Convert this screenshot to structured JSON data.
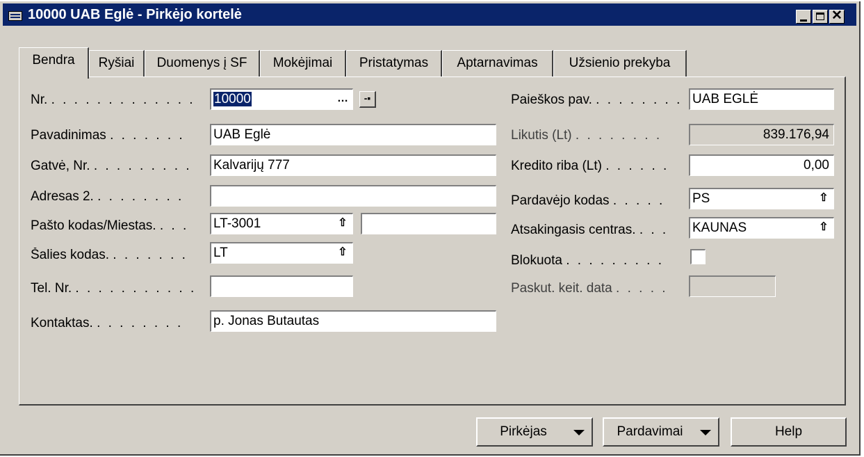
{
  "window": {
    "title": "10000 UAB Eglė - Pirkėjo kortelė",
    "close_glyph": "✕"
  },
  "tabs": [
    {
      "label": "Bendra"
    },
    {
      "label": "Ryšiai"
    },
    {
      "label": "Duomenys į SF"
    },
    {
      "label": "Mokėjimai"
    },
    {
      "label": "Pristatymas"
    },
    {
      "label": "Aptarnavimas"
    },
    {
      "label": "Užsienio prekyba"
    }
  ],
  "active_tab": "Bendra",
  "left_fields": {
    "nr": {
      "label": "Nr.",
      "dots": ". . . . . . . . . . . . .",
      "value": "10000"
    },
    "pavadinimas": {
      "label": "Pavadinimas",
      "dots": ". . . . . . .",
      "value": "UAB Eglė"
    },
    "gatve": {
      "label": "Gatvė, Nr.",
      "dots": ". . . . . . . . .",
      "value": "Kalvarijų 777"
    },
    "adresas2": {
      "label": "Adresas 2.",
      "dots": ". . . . . . . .",
      "value": ""
    },
    "pasto": {
      "label": "Pašto kodas/Miestas.",
      "dots": ". . .",
      "value": "LT-3001",
      "city": ""
    },
    "salies": {
      "label": "Šalies kodas.",
      "dots": ". . . . . . .",
      "value": "LT"
    },
    "tel": {
      "label": "Tel. Nr.",
      "dots": ". . . . . . . . . . .",
      "value": ""
    },
    "kontaktas": {
      "label": "Kontaktas.",
      "dots": ". . . . . . . .",
      "value": "p. Jonas Butautas"
    }
  },
  "right_fields": {
    "paieskos": {
      "label": "Paieškos pav.",
      "dots": ". . . . . . . .",
      "value": "UAB EGLĖ"
    },
    "likutis": {
      "label": "Likutis (Lt)",
      "dots": ". . . . . . . .",
      "value": "839.176,94"
    },
    "kredito": {
      "label": "Kredito riba (Lt)",
      "dots": ". . . . . .",
      "value": "0,00"
    },
    "pardavejo": {
      "label": "Pardavėjo kodas",
      "dots": ". . . . .",
      "value": "PS"
    },
    "atsakingasis": {
      "label": "Atsakingasis centras.",
      "dots": ". . .",
      "value": "KAUNAS"
    },
    "blokuota": {
      "label": "Blokuota",
      "dots": ". . . . . . . . .",
      "checked": false
    },
    "paskut": {
      "label": "Paskut. keit. data",
      "dots": ". . . . .",
      "value": ""
    }
  },
  "buttons": {
    "pirkejas": "Pirkėjas",
    "pardavimai": "Pardavimai",
    "help": "Help"
  },
  "icons": {
    "lookup": "…",
    "updown": "⇧",
    "card": "-▪"
  }
}
